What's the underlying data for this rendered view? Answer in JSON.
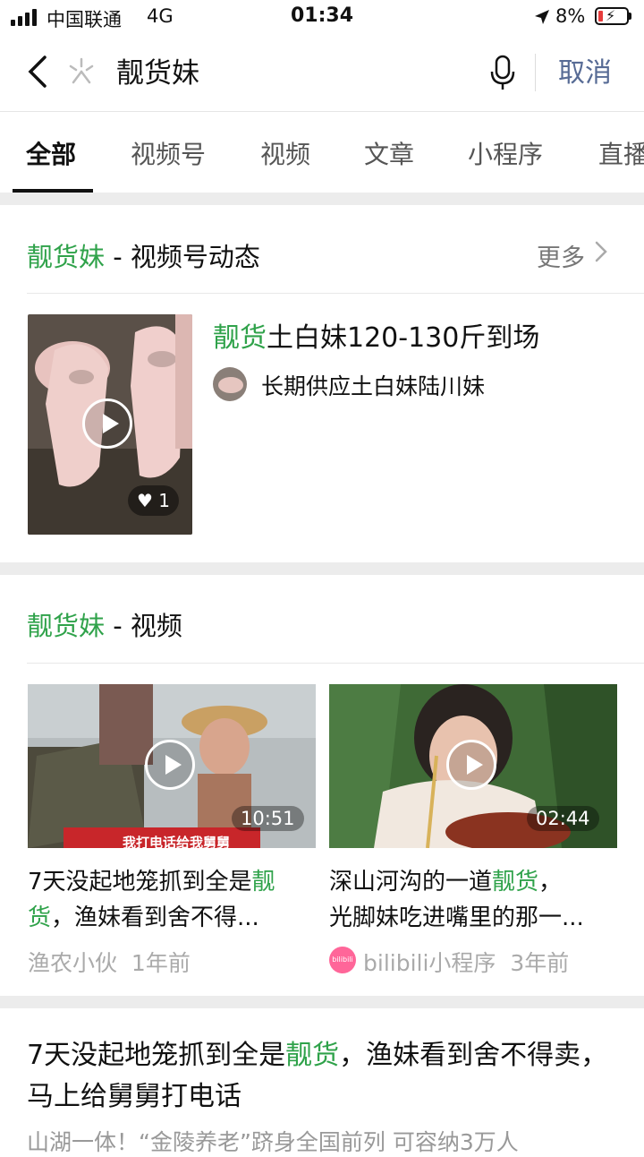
{
  "status": {
    "carrier": "中国联通",
    "network": "4G",
    "time": "01:34",
    "battery": "8%"
  },
  "search": {
    "back_icon": "chevron-left-icon",
    "query": "靓货妹",
    "cancel": "取消",
    "mic_icon": "mic-icon"
  },
  "tabs": [
    "全部",
    "视频号",
    "视频",
    "文章",
    "小程序",
    "直播"
  ],
  "section_channels": {
    "title_hl": "靓货妹",
    "title_rest": " - 视频号动态",
    "more": "更多",
    "item": {
      "title_hl": "靓货",
      "title_rest": "土白妹120-130斤到场",
      "author": "长期供应土白妹陆川妹",
      "likes": "1"
    }
  },
  "section_videos": {
    "title_hl": "靓货妹",
    "title_rest": " - 视频",
    "cards": [
      {
        "title_a": "7天没起地笼抓到全是",
        "title_hl1": "靓",
        "title_hl2": "货",
        "title_b": "，渔妹看到舍不得...",
        "duration": "10:51",
        "caption": "我打电话给我舅舅",
        "source": "渔农小伙",
        "time": "1年前"
      },
      {
        "title_a": "深山河沟的一道",
        "title_hl": "靓货",
        "title_b": "，",
        "title_line2": "光脚妹吃进嘴里的那一...",
        "duration": "02:44",
        "logo_text": "bilibili",
        "source": "bilibili小程序",
        "time": "3年前"
      }
    ]
  },
  "article": {
    "title_a": "7天没起地笼抓到全是",
    "title_hl": "靓货",
    "title_b": "，渔妹看到舍不得卖，马上给舅舅打电话",
    "snippet": "山湖一体！“金陵养老”跻身全国前列 可容纳3万人"
  },
  "colors": {
    "highlight": "#2fa24a",
    "link": "#576b95",
    "separator": "#ececec"
  }
}
